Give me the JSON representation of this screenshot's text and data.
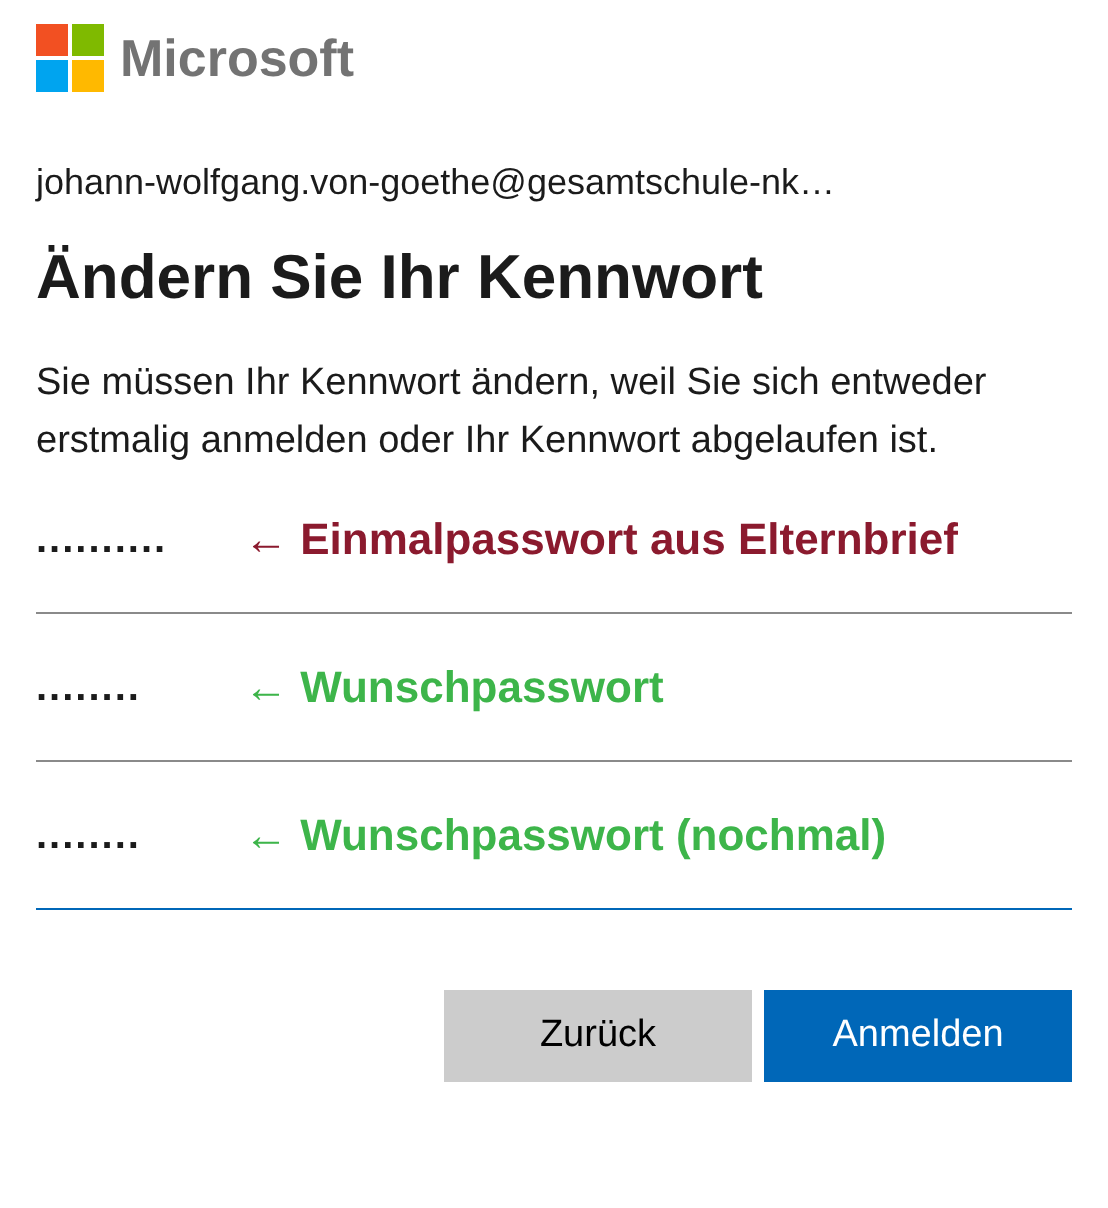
{
  "logo": {
    "text": "Microsoft"
  },
  "email": "johann-wolfgang.von-goethe@gesamtschule-nk…",
  "title": "Ändern Sie Ihr Kennwort",
  "description": "Sie müssen Ihr Kennwort ändern, weil Sie sich entweder erstmalig anmelden oder Ihr Kennwort abgelaufen ist.",
  "fields": [
    {
      "value": "..........",
      "focused": false,
      "annotation": {
        "text": "← Einmalpasswort aus Elternbrief",
        "color": "#8b1a2e"
      }
    },
    {
      "value": "........",
      "focused": false,
      "annotation": {
        "text": "← Wunschpasswort",
        "color": "#3db54a"
      }
    },
    {
      "value": "........",
      "focused": true,
      "annotation": {
        "text": "← Wunschpasswort (nochmal)",
        "color": "#3db54a"
      }
    }
  ],
  "buttons": [
    {
      "label": "Zurück",
      "kind": "secondary"
    },
    {
      "label": "Anmelden",
      "kind": "primary"
    }
  ]
}
